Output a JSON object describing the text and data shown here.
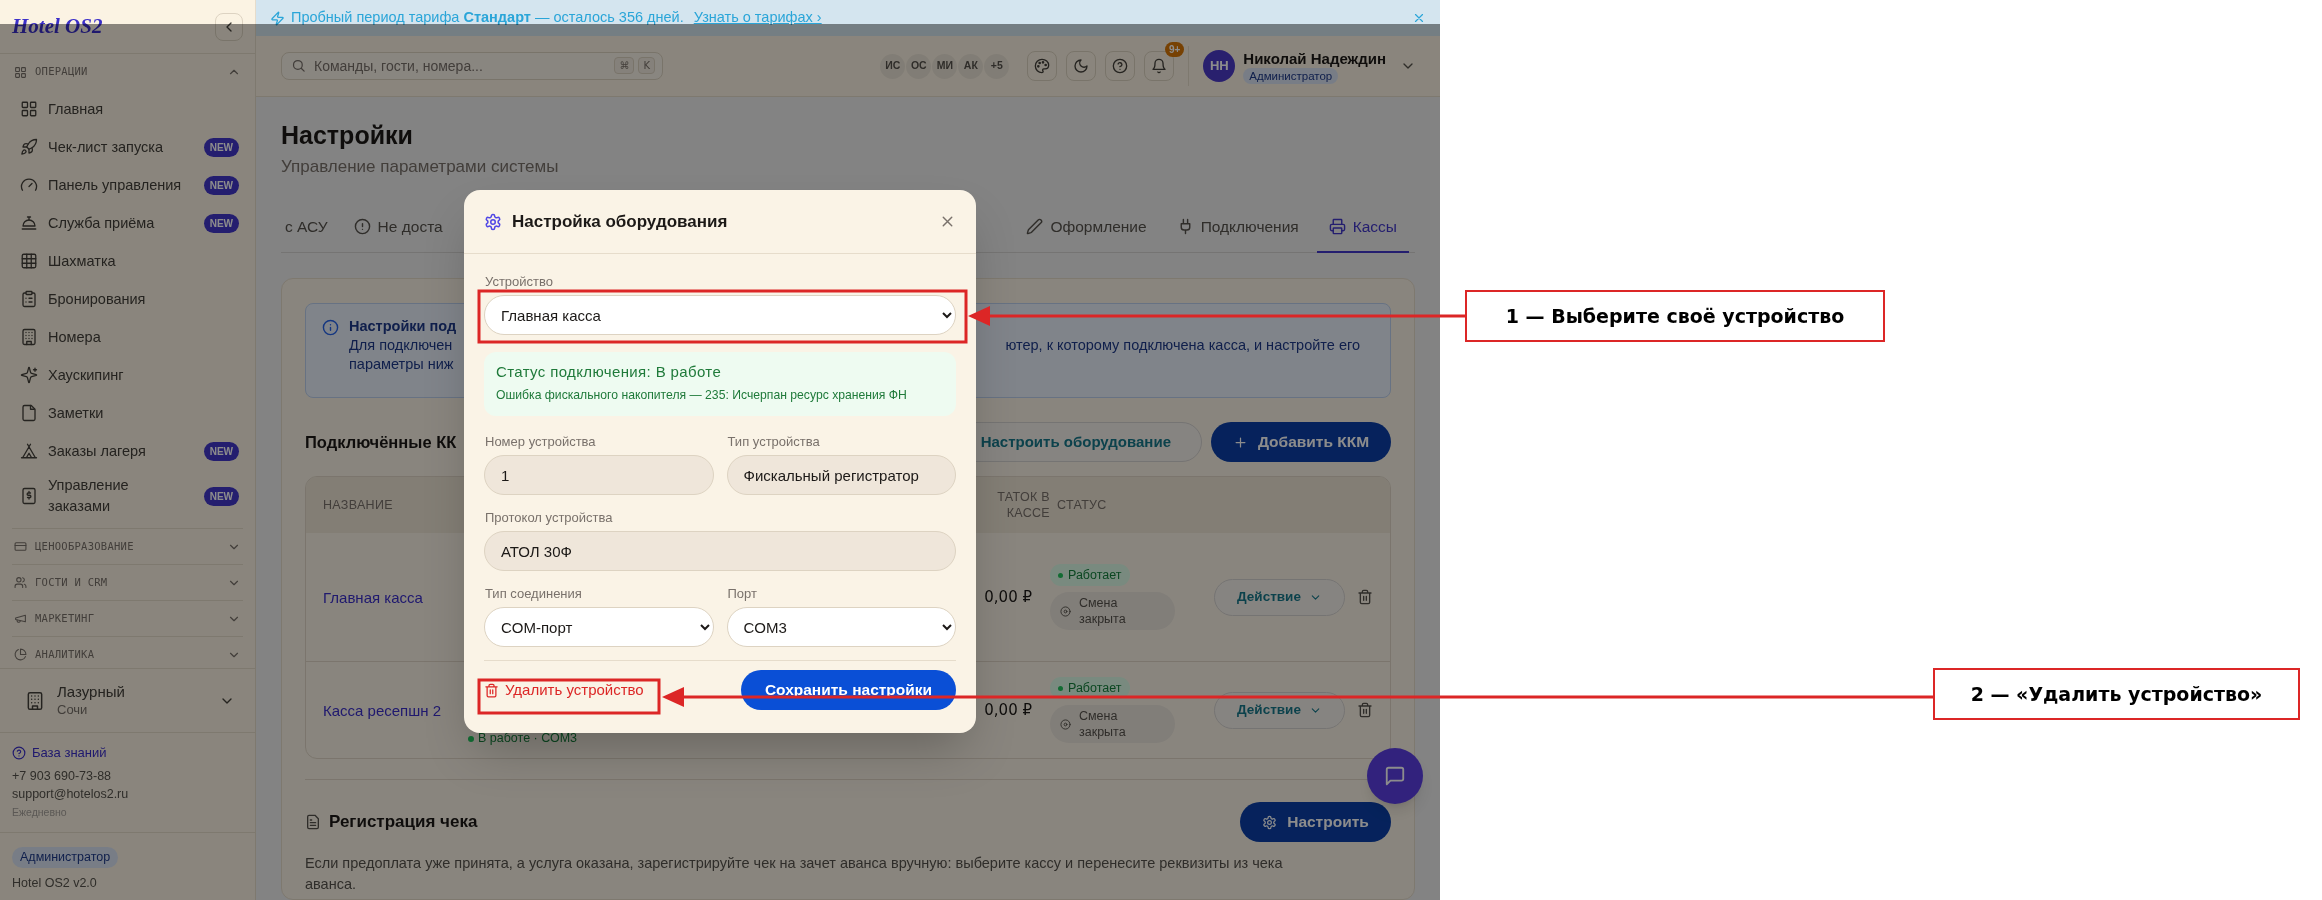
{
  "sidebar": {
    "logo": "Hotel OS2",
    "sections": [
      {
        "title": "ОПЕРАЦИИ",
        "expanded": true,
        "items": [
          {
            "label": "Главная"
          },
          {
            "label": "Чек-лист запуска",
            "badge": "NEW"
          },
          {
            "label": "Панель управления",
            "badge": "NEW"
          },
          {
            "label": "Служба приёма",
            "badge": "NEW"
          },
          {
            "label": "Шахматка"
          },
          {
            "label": "Бронирования"
          },
          {
            "label": "Номера"
          },
          {
            "label": "Хаускипинг"
          },
          {
            "label": "Заметки"
          },
          {
            "label": "Заказы лагеря",
            "badge": "NEW"
          },
          {
            "label": "Управление заказами",
            "badge": "NEW"
          }
        ]
      },
      {
        "title": "ЦЕНООБРАЗОВАНИЕ",
        "expanded": false
      },
      {
        "title": "ГОСТИ И CRM",
        "expanded": false
      },
      {
        "title": "МАРКЕТИНГ",
        "expanded": false
      },
      {
        "title": "АНАЛИТИКА",
        "expanded": false
      }
    ],
    "property": {
      "name": "Лазурный",
      "city": "Сочи"
    },
    "support": {
      "link": "База знаний",
      "phone": "+7 903 690-73-88",
      "email": "support@hotelos2.ru",
      "hours": "Ежедневно"
    },
    "role": "Администратор",
    "version": "Hotel OS2 v2.0"
  },
  "banner": {
    "text": "Пробный период тарифа **Стандарт** — осталось 356 дней.",
    "link": "Узнать о тарифах ›"
  },
  "header": {
    "search": {
      "placeholder": "Команды, гости, номера...",
      "keys": [
        "⌘",
        "K"
      ]
    },
    "avatars": [
      "ИС",
      "ОС",
      "МИ",
      "АК"
    ],
    "more": "+5",
    "notifications": "9+",
    "user": {
      "initials": "НН",
      "name": "Николай Надеждин",
      "role": "Администратор"
    }
  },
  "page": {
    "title": "Настройки",
    "subtitle": "Управление параметрами системы",
    "tabs": [
      {
        "label": "с АСУ",
        "selected": false
      },
      {
        "label": "Не доста",
        "selected": false
      },
      {
        "label": "Оформление",
        "selected": false
      },
      {
        "label": "Подключения",
        "selected": false
      },
      {
        "label": "Кассы",
        "selected": true
      }
    ],
    "notice": {
      "title": "Настройки под",
      "line_1_start": "Для подключен",
      "line_1_end": "ютер, к которому подключена касса, и настройте его",
      "line_2": "параметры ниж"
    },
    "kkm": {
      "title": "Подключённые КК",
      "configure_button": "Настроить оборудование",
      "add_button": "Добавить ККМ",
      "columns": [
        "НАЗВАНИЕ",
        "ТАТОК В КАССЕ",
        "СТАТУС"
      ],
      "rows": [
        {
          "name": "Главная касса",
          "amount": "0,00 ₽",
          "status": {
            "text": "Работает",
            "kind": "ok"
          },
          "shift": "Смена закрыта",
          "action": "Действие"
        },
        {
          "name": "Касса ресепшн 2",
          "connection": "В работе · СОМ3",
          "amount": "0,00 ₽",
          "status": {
            "text": "Работает",
            "kind": "ok"
          },
          "shift": "Смена закрыта",
          "action": "Действие"
        }
      ]
    },
    "receipt": {
      "title": "Регистрация чека",
      "button": "Настроить",
      "text": "Если предоплата уже принята, а услуга оказана, зарегистрируйте чек на зачет аванса вручную: выберите кассу и перенесите реквизиты из чека аванса."
    }
  },
  "modal": {
    "title": "Настройка оборудования",
    "device": {
      "label": "Устройство",
      "value": "Главная касса"
    },
    "status": {
      "title": "Статус подключения: В работе",
      "detail": "Ошибка фискального накопителя — 235: Исчерпан ресурс хранения ФН"
    },
    "device_number": {
      "label": "Номер устройства",
      "value": "1"
    },
    "device_type": {
      "label": "Тип устройства",
      "value": "Фискальный регистратор"
    },
    "protocol": {
      "label": "Протокол устройства",
      "value": "АТОЛ 30Ф"
    },
    "connection_type": {
      "label": "Тип соединения",
      "value": "COM-порт"
    },
    "port": {
      "label": "Порт",
      "value": "COM3"
    },
    "delete": "Удалить устройство",
    "save": "Сохранить настройки"
  },
  "annotations": [
    {
      "label": "1 — Выберите своё устройство"
    },
    {
      "label": "2 — «Удалить устройство»"
    }
  ]
}
